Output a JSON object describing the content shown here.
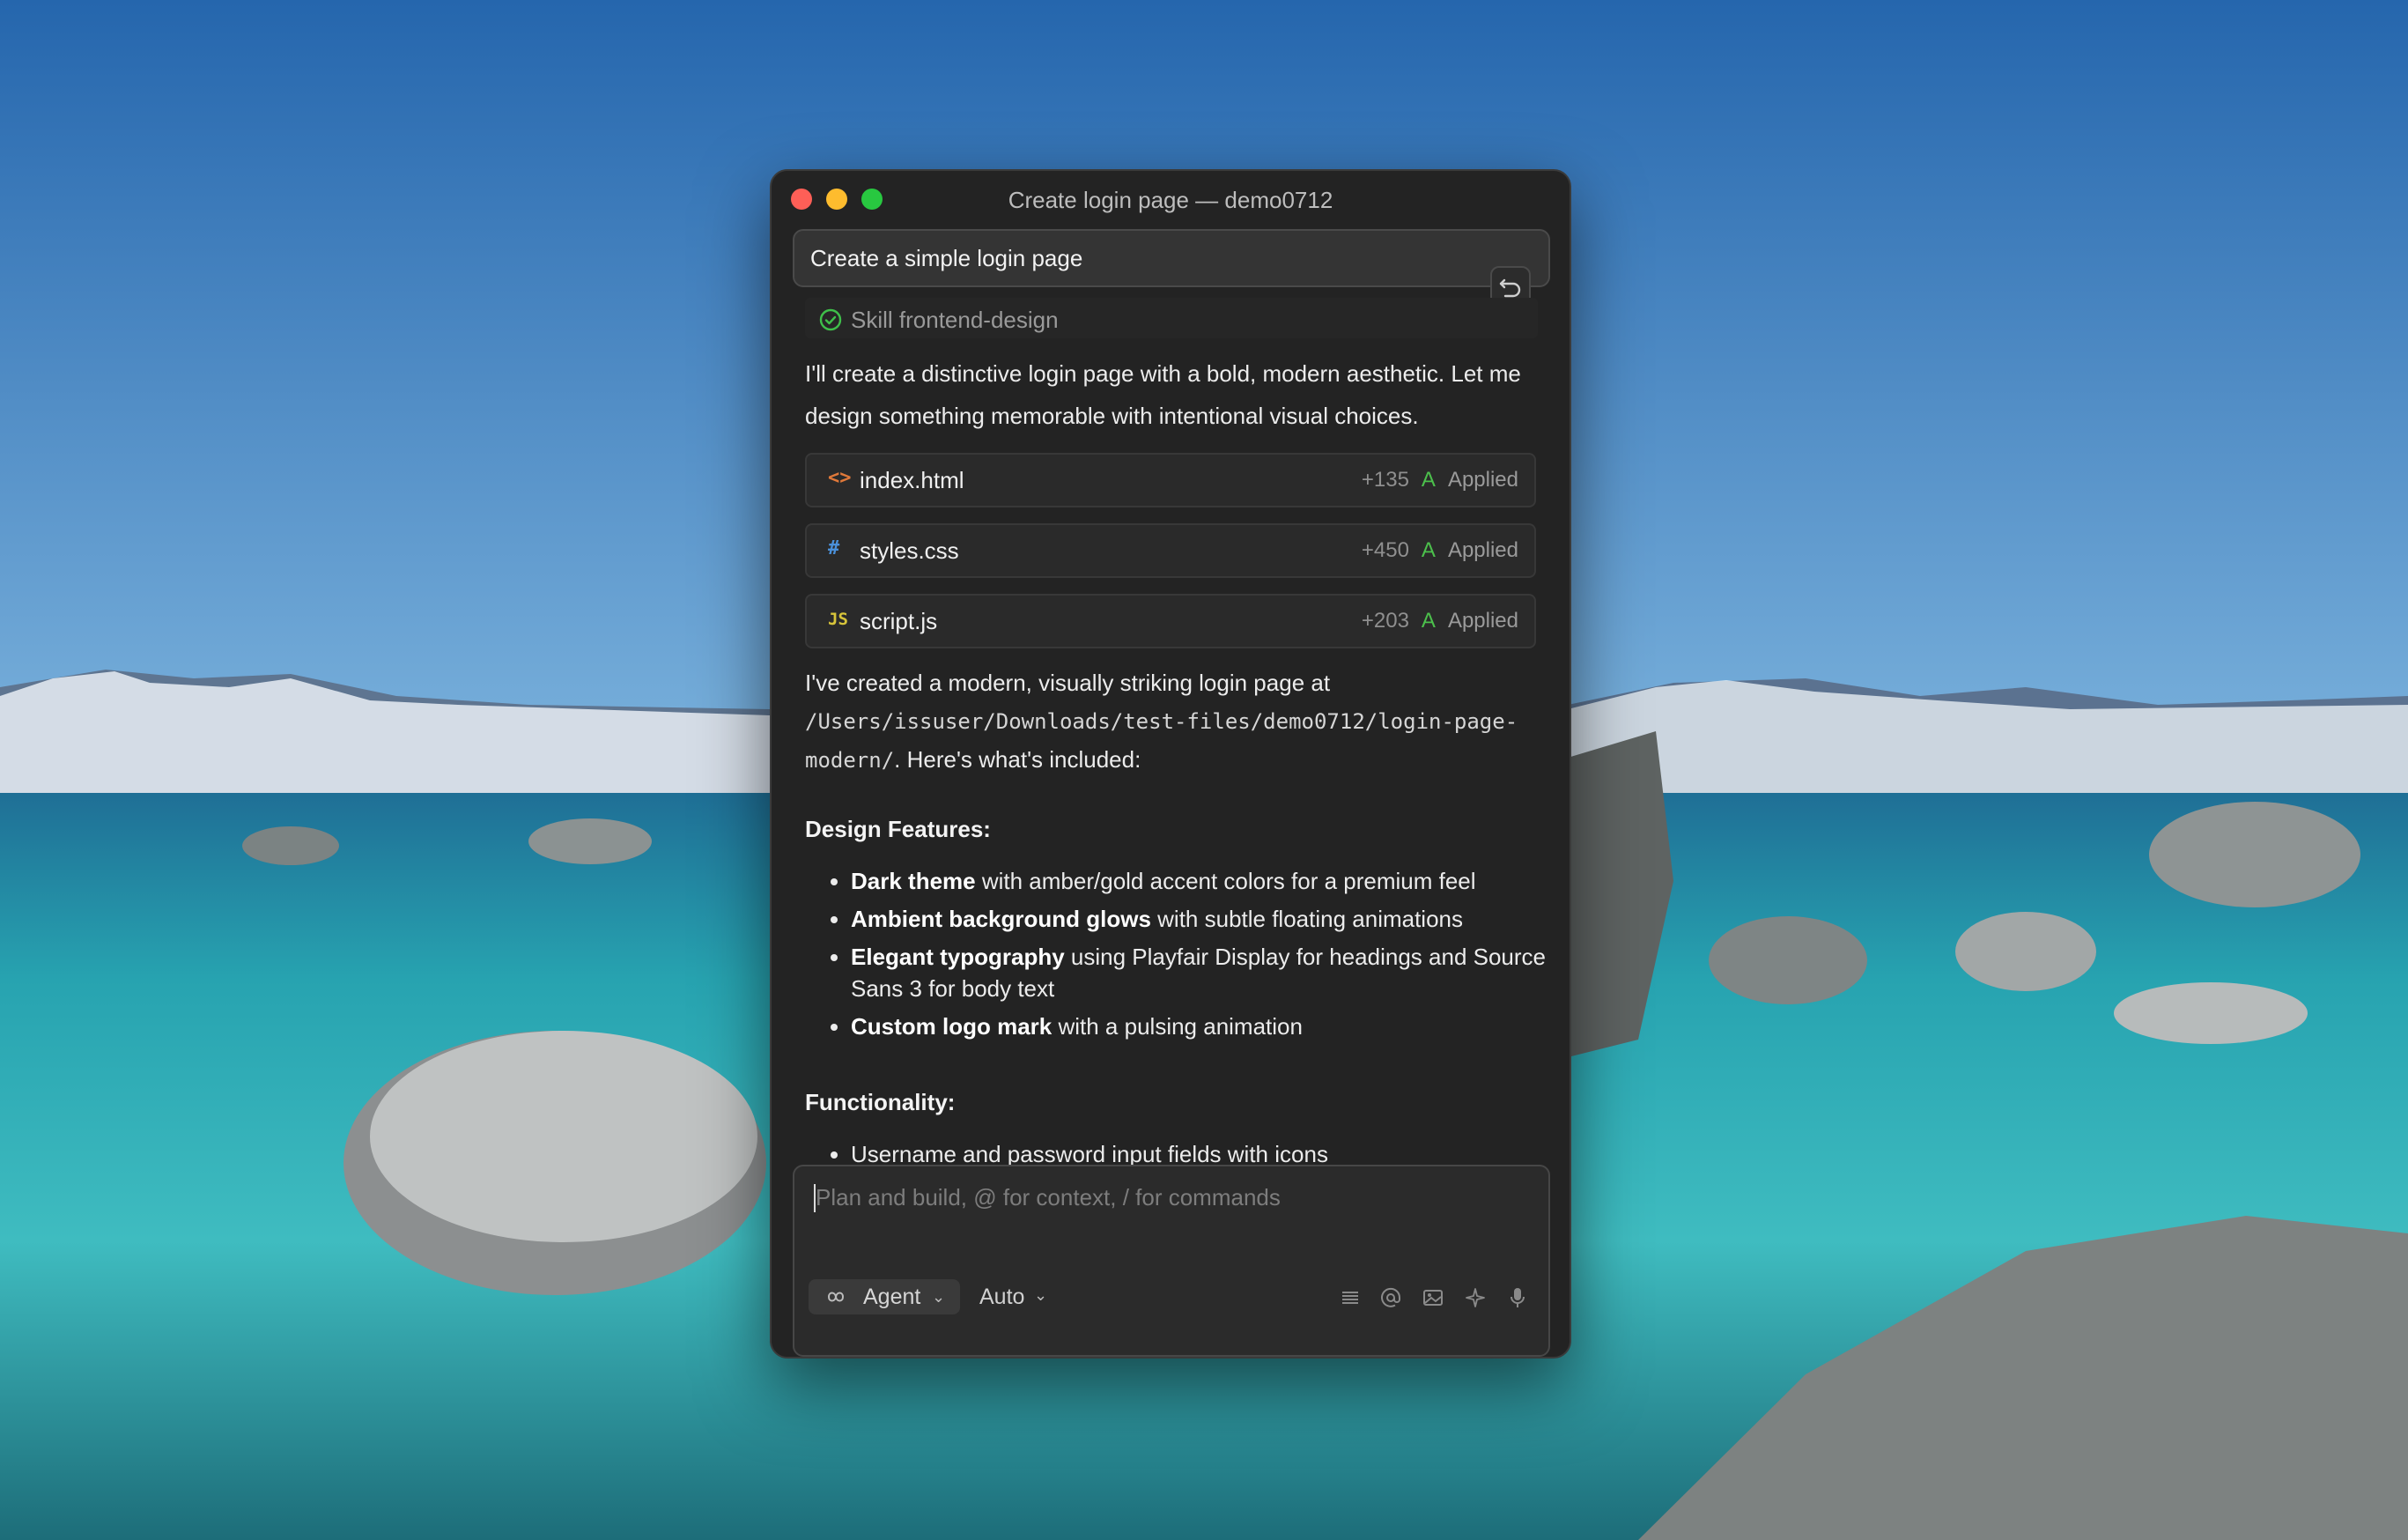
{
  "window": {
    "title": "Create login page — demo0712"
  },
  "prompt": {
    "text": "Create a simple login page"
  },
  "skill": {
    "label": "Skill frontend-design"
  },
  "messages": {
    "intro": "I'll create a distinctive login page with a bold, modern aesthetic. Let me design something memorable with intentional visual choices.",
    "summary_prefix": "I've created a modern, visually striking login page at ",
    "summary_path": "/Users/issuser/Downloads/test-files/demo0712/login-page-modern/",
    "summary_suffix": ". Here's what's included:"
  },
  "files": [
    {
      "icon": "<>",
      "name": "index.html",
      "additions": "+135",
      "status": "A",
      "state": "Applied",
      "icon_color": "#e0793a"
    },
    {
      "icon": "#",
      "name": "styles.css",
      "additions": "+450",
      "status": "A",
      "state": "Applied",
      "icon_color": "#4a90d9"
    },
    {
      "icon": "JS",
      "name": "script.js",
      "additions": "+203",
      "status": "A",
      "state": "Applied",
      "icon_color": "#d7c43a"
    }
  ],
  "design_features": {
    "heading": "Design Features:",
    "items": [
      {
        "bold": "Dark theme",
        "rest": " with amber/gold accent colors for a premium feel"
      },
      {
        "bold": "Ambient background glows",
        "rest": " with subtle floating animations"
      },
      {
        "bold": "Elegant typography",
        "rest": " using Playfair Display for headings and Source Sans 3 for body text"
      },
      {
        "bold": "Custom logo mark",
        "rest": " with a pulsing animation"
      }
    ]
  },
  "functionality": {
    "heading": "Functionality:",
    "items": [
      {
        "text": "Username and password input fields with icons"
      }
    ]
  },
  "composer": {
    "placeholder": "Plan and build, @ for context, / for commands",
    "mode_label": "Agent",
    "model_label": "Auto"
  },
  "colors": {
    "window_bg": "#232323",
    "status_added": "#4cc04c",
    "skill_check": "#3fbf4a"
  },
  "icons": [
    "close-button",
    "minimize-button",
    "zoom-button",
    "undo-icon",
    "check-circle-icon",
    "infinity-icon",
    "chevron-down-icon",
    "list-icon",
    "at-icon",
    "image-icon",
    "sparkle-icon",
    "microphone-icon"
  ]
}
